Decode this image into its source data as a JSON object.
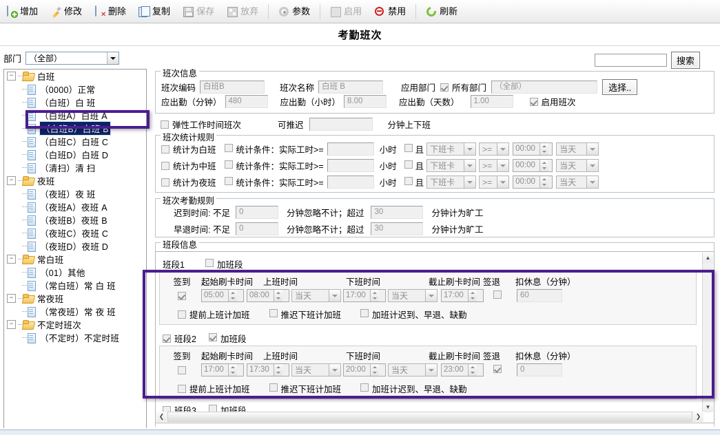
{
  "toolbar": {
    "buttons": [
      {
        "label": "增加",
        "icon": "add-document-icon",
        "disabled": false
      },
      {
        "label": "修改",
        "icon": "edit-pencil-icon",
        "disabled": false
      },
      {
        "label": "删除",
        "icon": "delete-document-icon",
        "disabled": false
      },
      {
        "label": "复制",
        "icon": "copy-icon",
        "disabled": false
      },
      {
        "label": "保存",
        "icon": "save-disk-icon",
        "disabled": true
      },
      {
        "label": "放弃",
        "icon": "discard-icon",
        "disabled": true
      },
      {
        "label": "参数",
        "icon": "gear-icon",
        "disabled": false
      },
      {
        "label": "启用",
        "icon": "enable-icon",
        "disabled": true
      },
      {
        "label": "禁用",
        "icon": "ban-icon",
        "disabled": false
      },
      {
        "label": "刷新",
        "icon": "refresh-icon",
        "disabled": false
      }
    ]
  },
  "page": {
    "title": "考勤班次"
  },
  "search": {
    "value": "",
    "button_label": "搜索"
  },
  "department": {
    "label": "部门",
    "value": "（全部）"
  },
  "tree": {
    "nodes": [
      {
        "type": "folder",
        "label": "白班",
        "expanded": true
      },
      {
        "type": "file",
        "label": "（0000）正常"
      },
      {
        "type": "file",
        "label": "（白班）白 班"
      },
      {
        "type": "file",
        "label": "（白班A）白班 A"
      },
      {
        "type": "file",
        "label": "（白班B）白班 B",
        "selected": true
      },
      {
        "type": "file",
        "label": "（白班C）白班 C"
      },
      {
        "type": "file",
        "label": "（白班D）白班 D"
      },
      {
        "type": "file",
        "label": "（清扫）清 扫"
      },
      {
        "type": "folder",
        "label": "夜班",
        "expanded": true
      },
      {
        "type": "file",
        "label": "（夜班）夜 班"
      },
      {
        "type": "file",
        "label": "（夜班A）夜班 A"
      },
      {
        "type": "file",
        "label": "（夜班B）夜班 B"
      },
      {
        "type": "file",
        "label": "（夜班C）夜班 C"
      },
      {
        "type": "file",
        "label": "（夜班D）夜班 D"
      },
      {
        "type": "folder",
        "label": "常白班",
        "expanded": true
      },
      {
        "type": "file",
        "label": "（01）其他"
      },
      {
        "type": "file",
        "label": "（常白班）常 白 班"
      },
      {
        "type": "folder",
        "label": "常夜班",
        "expanded": true
      },
      {
        "type": "file",
        "label": "（常夜班）常 夜 班"
      },
      {
        "type": "folder",
        "label": "不定时班次",
        "expanded": true
      },
      {
        "type": "file",
        "label": "（不定时）不定时班"
      }
    ]
  },
  "shift_info": {
    "legend": "班次信息",
    "code_label": "班次编码",
    "code_value": "白班B",
    "name_label": "班次名称",
    "name_value": "白班 B",
    "apply_dept_label": "应用部门",
    "all_dept_label": "所有部门",
    "all_dept_checked": true,
    "dept_value": "（全部）",
    "select_button": "选择..",
    "minutes_label": "应出勤（分钟）",
    "minutes_value": "480",
    "hours_label": "应出勤（小时）",
    "hours_value": "8.00",
    "days_label": "应出勤（天数）",
    "days_value": "1.00",
    "enable_shift_label": "启用班次",
    "enable_shift_checked": true
  },
  "flexible": {
    "checkbox_label": "弹性工作时间班次",
    "checked": false,
    "delay_label": "可推迟",
    "delay_value": "",
    "suffix_label": "分钟上下班"
  },
  "stat_rules": {
    "legend": "班次统计规则",
    "cond_label": "统计条件：实际工时>=",
    "hour_label": "小时",
    "and_label": "且",
    "rows": [
      {
        "as_label": "统计为白班",
        "as_checked": false,
        "hours": "",
        "and_checked": false,
        "card": "下班卡",
        "op": ">=",
        "time": "00:00",
        "day": "当天"
      },
      {
        "as_label": "统计为中班",
        "as_checked": false,
        "hours": "",
        "and_checked": false,
        "card": "下班卡",
        "op": ">=",
        "time": "00:00",
        "day": "当天"
      },
      {
        "as_label": "统计为夜班",
        "as_checked": false,
        "hours": "",
        "and_checked": false,
        "card": "下班卡",
        "op": ">=",
        "time": "00:00",
        "day": "当天"
      }
    ]
  },
  "attend_rules": {
    "legend": "班次考勤规则",
    "rows": [
      {
        "label": "迟到时间: 不足",
        "v1": "0",
        "mid": "分钟忽略不计；超过",
        "v2": "30",
        "tail": "分钟计为旷工"
      },
      {
        "label": "早退时间: 不足",
        "v1": "0",
        "mid": "分钟忽略不计；超过",
        "v2": "30",
        "tail": "分钟计为旷工"
      }
    ]
  },
  "segments": {
    "legend": "班段信息",
    "columns": {
      "signin": "签到",
      "start_card": "起始刷卡时间",
      "on_time": "上班时间",
      "off_time": "下班时间",
      "end_card": "截止刷卡时间",
      "signout": "签退",
      "deduct": "扣休息（分钟）"
    },
    "options": {
      "early_ot": "提前上班计加班",
      "late_ot": "推迟下班计加班",
      "ot_late_early_absent": "加班计迟到、早退、缺勤"
    },
    "overtime_label": "加班段",
    "items": [
      {
        "name": "班段1",
        "enabled": true,
        "enabled_visible": false,
        "overtime": false,
        "signin": true,
        "start_card": "05:00",
        "on_time": "08:00",
        "on_day": "当天",
        "off_time": "17:00",
        "off_day": "当天",
        "end_card": "17:00",
        "signout": false,
        "deduct": "60",
        "early_ot": false,
        "late_ot": false,
        "ot_flag": false
      },
      {
        "name": "班段2",
        "enabled": true,
        "enabled_visible": true,
        "overtime": true,
        "signin": false,
        "start_card": "17:00",
        "on_time": "17:30",
        "on_day": "当天",
        "off_time": "20:00",
        "off_day": "当天",
        "end_card": "23:00",
        "signout": true,
        "deduct": "0",
        "early_ot": false,
        "late_ot": false,
        "ot_flag": false
      },
      {
        "name": "班段3",
        "enabled": false,
        "enabled_visible": true,
        "overtime": false
      }
    ]
  },
  "colors": {
    "highlight": "#4b1d8e",
    "selection": "#0a246a",
    "accent": "#b9c3cc"
  }
}
